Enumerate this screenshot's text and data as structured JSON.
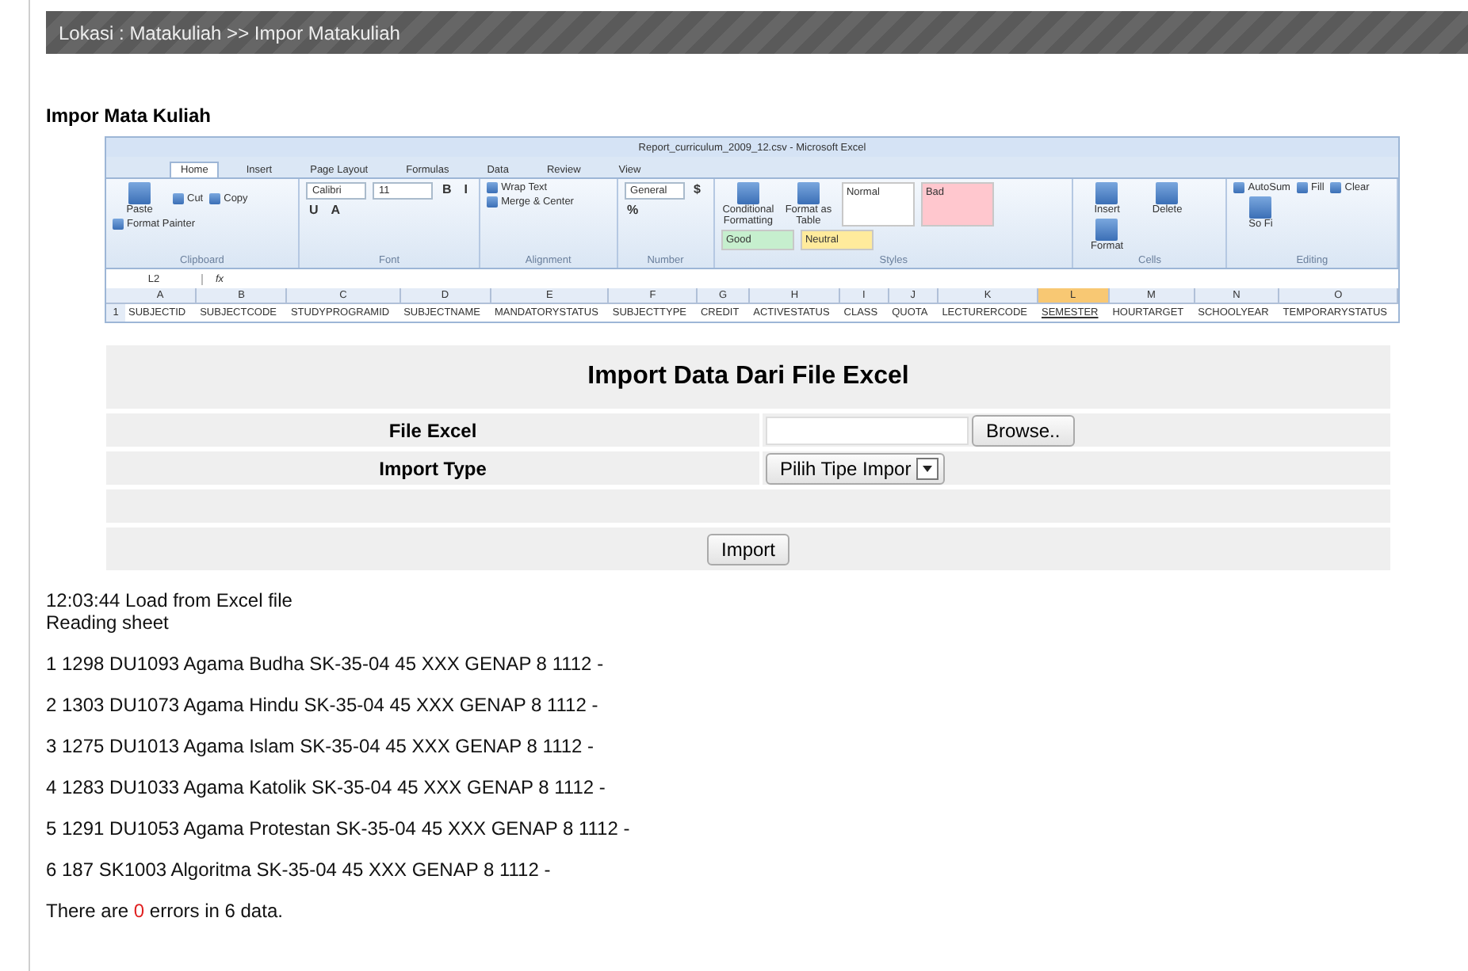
{
  "breadcrumb": "Lokasi : Matakuliah >> Impor Matakuliah",
  "page_title": "Impor Mata Kuliah",
  "excel_screenshot": {
    "title": "Report_curriculum_2009_12.csv - Microsoft Excel",
    "tabs": [
      {
        "label": "Home",
        "selected": true
      },
      {
        "label": "Insert",
        "selected": false
      },
      {
        "label": "Page Layout",
        "selected": false
      },
      {
        "label": "Formulas",
        "selected": false
      },
      {
        "label": "Data",
        "selected": false
      },
      {
        "label": "Review",
        "selected": false
      },
      {
        "label": "View",
        "selected": false
      }
    ],
    "ribbon_groups": [
      {
        "label": "Clipboard",
        "items": [
          {
            "kind": "large",
            "label": "Paste"
          },
          {
            "kind": "small",
            "label": "Cut"
          },
          {
            "kind": "small",
            "label": "Copy"
          },
          {
            "kind": "small",
            "label": "Format Painter"
          }
        ]
      },
      {
        "label": "Font",
        "items": [
          {
            "kind": "combo",
            "label": "Calibri"
          },
          {
            "kind": "combo",
            "label": "11"
          },
          {
            "kind": "glyph",
            "label": "B"
          },
          {
            "kind": "glyph",
            "label": "I"
          },
          {
            "kind": "glyph",
            "label": "U"
          },
          {
            "kind": "glyph",
            "label": "A"
          }
        ]
      },
      {
        "label": "Alignment",
        "items": [
          {
            "kind": "small",
            "label": "Wrap Text"
          },
          {
            "kind": "small",
            "label": "Merge & Center"
          }
        ]
      },
      {
        "label": "Number",
        "items": [
          {
            "kind": "combo",
            "label": "General"
          },
          {
            "kind": "glyph",
            "label": "$"
          },
          {
            "kind": "glyph",
            "label": "%"
          }
        ]
      },
      {
        "label": "Styles",
        "items": [
          {
            "kind": "large",
            "label": "Conditional Formatting"
          },
          {
            "kind": "large",
            "label": "Format as Table"
          },
          {
            "kind": "style",
            "label": "Normal",
            "color": "#ffffff"
          },
          {
            "kind": "style",
            "label": "Bad",
            "color": "#ffc7ce"
          },
          {
            "kind": "style",
            "label": "Good",
            "color": "#c6efce"
          },
          {
            "kind": "style",
            "label": "Neutral",
            "color": "#ffeb9c"
          }
        ]
      },
      {
        "label": "Cells",
        "items": [
          {
            "kind": "large",
            "label": "Insert"
          },
          {
            "kind": "large",
            "label": "Delete"
          },
          {
            "kind": "large",
            "label": "Format"
          }
        ]
      },
      {
        "label": "Editing",
        "items": [
          {
            "kind": "small",
            "label": "AutoSum"
          },
          {
            "kind": "small",
            "label": "Fill"
          },
          {
            "kind": "small",
            "label": "Clear"
          },
          {
            "kind": "large",
            "label": "So Fi"
          }
        ]
      }
    ],
    "name_box": "L2",
    "formula_symbol": "fx",
    "row_number": "1",
    "columns": [
      {
        "letter": "A",
        "header": "SUBJECTID",
        "selected": false
      },
      {
        "letter": "B",
        "header": "SUBJECTCODE",
        "selected": false
      },
      {
        "letter": "C",
        "header": "STUDYPROGRAMID",
        "selected": false
      },
      {
        "letter": "D",
        "header": "SUBJECTNAME",
        "selected": false
      },
      {
        "letter": "E",
        "header": "MANDATORYSTATUS",
        "selected": false
      },
      {
        "letter": "F",
        "header": "SUBJECTTYPE",
        "selected": false
      },
      {
        "letter": "G",
        "header": "CREDIT",
        "selected": false
      },
      {
        "letter": "H",
        "header": "ACTIVESTATUS",
        "selected": false
      },
      {
        "letter": "I",
        "header": "CLASS",
        "selected": false
      },
      {
        "letter": "J",
        "header": "QUOTA",
        "selected": false
      },
      {
        "letter": "K",
        "header": "LECTURERCODE",
        "selected": false
      },
      {
        "letter": "L",
        "header": "SEMESTER",
        "selected": true
      },
      {
        "letter": "M",
        "header": "HOURTARGET",
        "selected": false
      },
      {
        "letter": "N",
        "header": "SCHOOLYEAR",
        "selected": false
      },
      {
        "letter": "O",
        "header": "TEMPORARYSTATUS",
        "selected": false
      }
    ]
  },
  "import_form": {
    "heading": "Import Data Dari File Excel",
    "file_label": "File Excel",
    "browse_button": "Browse..",
    "type_label": "Import Type",
    "type_select": "Pilih Tipe Impor",
    "submit_button": "Import"
  },
  "log": {
    "header_lines": [
      "12:03:44 Load from Excel file",
      "Reading sheet"
    ],
    "rows": [
      "1 1298 DU1093 Agama Budha SK-35-04 45 XXX GENAP 8 1112 -",
      "2 1303 DU1073 Agama Hindu SK-35-04 45 XXX GENAP 8 1112 -",
      "3 1275 DU1013 Agama Islam SK-35-04 45 XXX GENAP 8 1112 -",
      "4 1283 DU1033 Agama Katolik SK-35-04 45 XXX GENAP 8 1112 -",
      "5 1291 DU1053 Agama Protestan SK-35-04 45 XXX GENAP 8 1112 -",
      "6 187 SK1003 Algoritma SK-35-04 45 XXX GENAP 8 1112 -"
    ],
    "summary": {
      "before": "There are",
      "errors": "0",
      "after": "errors in 6 data."
    }
  }
}
